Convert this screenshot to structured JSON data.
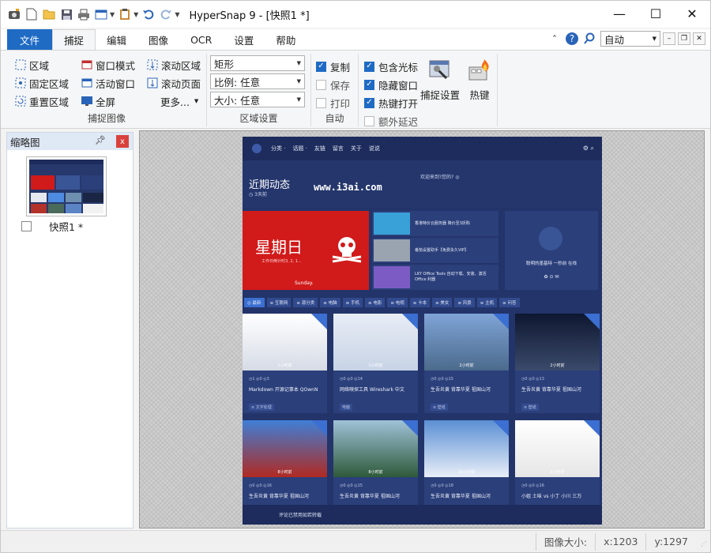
{
  "window": {
    "title": "HyperSnap 9 - [快照1 *]",
    "min": "—",
    "max": "☐",
    "close": "✕"
  },
  "quick_access": {
    "icons": [
      "camera-icon",
      "new-file-icon",
      "open-folder-icon",
      "save-icon",
      "print-icon",
      "window-icon",
      "dropdown-arrow",
      "clipboard-icon",
      "dropdown-arrow",
      "undo-icon",
      "redo-icon",
      "customize-arrow"
    ]
  },
  "tabs": {
    "file": "文件",
    "capture": "捕捉",
    "edit": "编辑",
    "image": "图像",
    "ocr": "OCR",
    "settings": "设置",
    "help": "帮助",
    "zoom_value": "自动"
  },
  "ribbon": {
    "capture_images": {
      "label": "捕捉图像",
      "region": "区域",
      "fixed_region": "固定区域",
      "repeat_region": "重置区域",
      "window_mode": "窗口模式",
      "active_window": "活动窗口",
      "fullscreen": "全屏",
      "scroll_region": "滚动区域",
      "scroll_page": "滚动页面",
      "more": "更多..."
    },
    "region_settings": {
      "label": "区域设置",
      "shape": "矩形",
      "ratio": "比例: 任意",
      "size": "大小: 任意"
    },
    "auto": {
      "label": "自动",
      "copy": "复制",
      "save": "保存",
      "print": "打印"
    },
    "options": {
      "include_cursor": "包含光标",
      "hide_window": "隐藏窗口",
      "hotkeys_on": "热键打开",
      "extra_delay": "额外延迟",
      "capture_settings": "捕捉设置",
      "hotkeys": "热键"
    }
  },
  "thumbnails": {
    "title": "缩略图",
    "pin": "ꟷ",
    "close": "x",
    "item_label": "快照1 *"
  },
  "screenshot": {
    "nav": [
      "分类 ·",
      "话题 ·",
      "友链",
      "留言",
      "关于",
      "说说"
    ],
    "banner_title": "近期动态",
    "banner_sub": "◷ 3天前",
    "banner_question": "欢迎来到?您的?  ◎",
    "watermark": "www.i3ai.com",
    "hero_title": "星期日",
    "hero_sub": "工作日倒计时3, 2, 1...",
    "hero_en": "Sunday.",
    "list": [
      "香港特价云服务器 降价至3折购",
      "番茄设置助手【免费永久VIP】",
      "LKY Office Tools 自动下载、安装、激活 Office 利器"
    ],
    "side_text": "聪明的墨基特 一秒前 在线",
    "side_icons": "✿  ⊙  ✉",
    "categories": [
      "◎ 最新",
      "≡ 互联网",
      "≡ 源分类",
      "≡ 电脑",
      "≡ 手机",
      "≡ 电影",
      "≡ 电视",
      "≡ 卡本",
      "≡ 美女",
      "≡ 风景",
      "≡ 主机",
      "≡ 问答"
    ],
    "cards": [
      {
        "time": "1小时前",
        "meta": "◷1  ◎0  ◎3",
        "title": "Markdown 开源记事本 QOwnN",
        "tag": "≡ 文字处理"
      },
      {
        "time": "1小时前",
        "meta": "◷0  ◎0  ◎14",
        "title": "网络嗅探工具 Wireshark 中文",
        "tag": "电脑"
      },
      {
        "time": "2小时前",
        "meta": "◷0  ◎0  ◎15",
        "title": "生吾炎黄 背靠华夏 祖国山河",
        "tag": "≡ 壁纸"
      },
      {
        "time": "2小时前",
        "meta": "◷0  ◎0  ◎13",
        "title": "生吾炎黄 背靠华夏 祖国山河",
        "tag": "≡ 壁纸"
      },
      {
        "time": "8小时前",
        "meta": "◷0  ◎0  ◎16",
        "title": "生吾炎黄 背靠华夏 祖国山河",
        "tag": ""
      },
      {
        "time": "8小时前",
        "meta": "◷0  ◎0  ◎15",
        "title": "生吾炎黄 背靠华夏 祖国山河",
        "tag": ""
      },
      {
        "time": "20小时前",
        "meta": "◷0  ◎0  ◎18",
        "title": "生吾炎黄 背靠华夏 祖国山河",
        "tag": ""
      },
      {
        "time": "2小时前",
        "meta": "◷0  ◎0  ◎16",
        "title": "小姐 土味 vs 小丁 小川 三万",
        "tag": ""
      }
    ],
    "footer": "评论已禁用如若转载"
  },
  "status": {
    "image_size_label": "图像大小:",
    "x": "x:1203",
    "y": "y:1297"
  },
  "colors": {
    "accent": "#1f6bc4",
    "page_bg": "#23346a",
    "hero_red": "#d11a1a"
  }
}
